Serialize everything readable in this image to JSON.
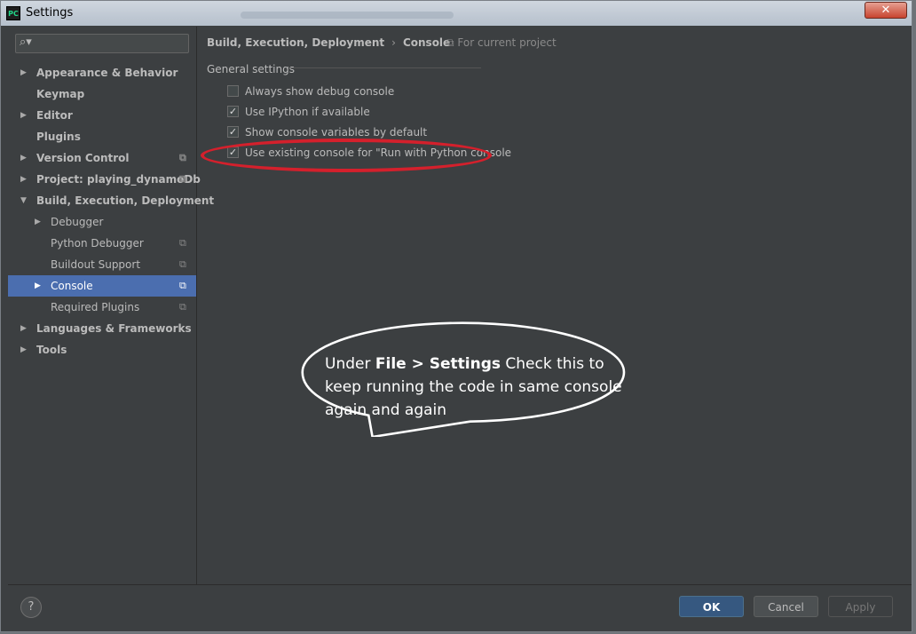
{
  "window": {
    "title": "Settings",
    "app_badge": "PC",
    "close_label": "✕"
  },
  "search": {
    "icon": "search-icon",
    "placeholder": ""
  },
  "sidebar": {
    "items": [
      {
        "label": "Appearance & Behavior",
        "arrow": "▶"
      },
      {
        "label": "Keymap",
        "arrow": ""
      },
      {
        "label": "Editor",
        "arrow": "▶"
      },
      {
        "label": "Plugins",
        "arrow": ""
      },
      {
        "label": "Version Control",
        "arrow": "▶",
        "project_icon": "⧉"
      },
      {
        "label": "Project: playing_dynamoDb",
        "arrow": "▶",
        "project_icon": "⧉"
      },
      {
        "label": "Build, Execution, Deployment",
        "arrow": "▼"
      },
      {
        "label": "Debugger",
        "arrow": "▶"
      },
      {
        "label": "Python Debugger",
        "arrow": "",
        "project_icon": "⧉"
      },
      {
        "label": "Buildout Support",
        "arrow": "",
        "project_icon": "⧉"
      },
      {
        "label": "Console",
        "arrow": "▶",
        "project_icon": "⧉",
        "selected": true
      },
      {
        "label": "Required Plugins",
        "arrow": "",
        "project_icon": "⧉"
      },
      {
        "label": "Languages & Frameworks",
        "arrow": "▶"
      },
      {
        "label": "Tools",
        "arrow": "▶"
      }
    ]
  },
  "content": {
    "breadcrumb": {
      "parent": "Build, Execution, Deployment",
      "separator": "›",
      "current": "Console"
    },
    "scope": "For current project",
    "scope_icon": "⧉",
    "section_title": "General settings",
    "options": [
      {
        "label": "Always show debug console",
        "checked": false
      },
      {
        "label": "Use IPython if available",
        "checked": true
      },
      {
        "label": "Show console variables by default",
        "checked": true
      },
      {
        "label": "Use existing console for \"Run with Python console",
        "checked": true
      }
    ],
    "callout": {
      "prefix": "Under ",
      "emphasis": "File > Settings",
      "suffix": " Check this to keep running the code in same console again and again"
    }
  },
  "footer": {
    "help_label": "?",
    "ok_label": "OK",
    "cancel_label": "Cancel",
    "apply_label": "Apply"
  },
  "colors": {
    "background": "#3c3f41",
    "selection": "#4b6eaf",
    "highlight": "#d4202c",
    "ok_button": "#365880"
  }
}
